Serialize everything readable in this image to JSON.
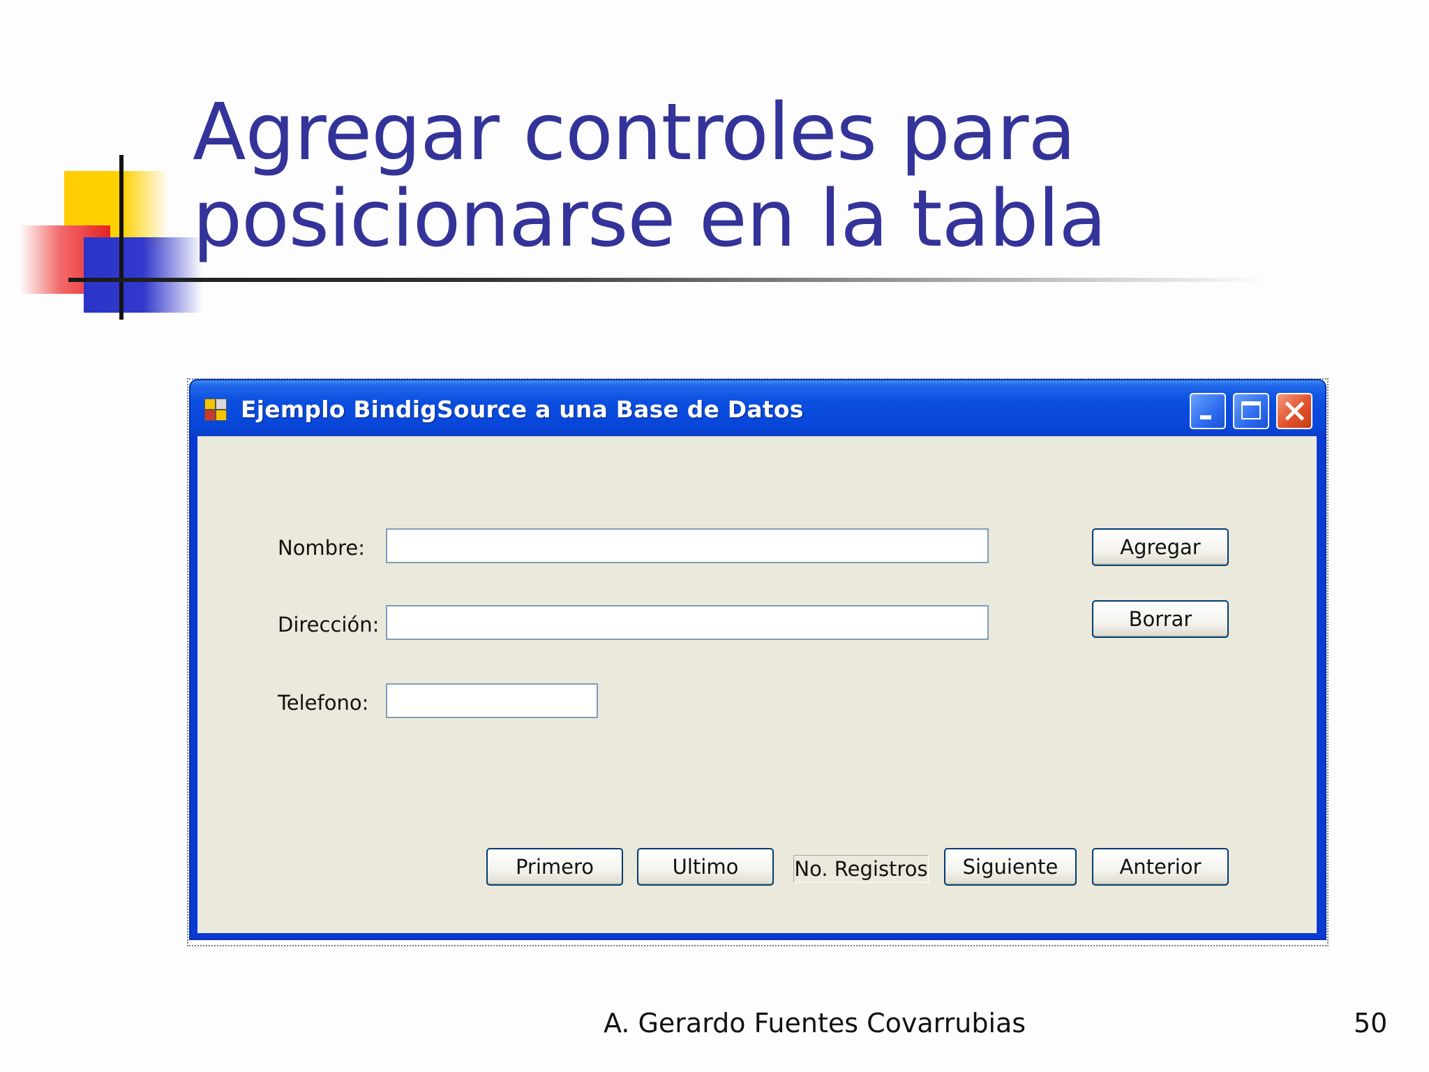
{
  "slide": {
    "title": "Agregar controles para posicionarse en la tabla",
    "author": "A. Gerardo Fuentes Covarrubias",
    "page_number": "50"
  },
  "window": {
    "title": "Ejemplo BindigSource a una Base de Datos",
    "titlebar_color": "#0a4ee0",
    "client_color": "#ebe9db"
  },
  "form": {
    "nombre_label": "Nombre:",
    "nombre_value": "",
    "direccion_label": "Dirección:",
    "direccion_value": "",
    "telefono_label": "Telefono:",
    "telefono_value": "",
    "agregar_label": "Agregar",
    "borrar_label": "Borrar",
    "primero_label": "Primero",
    "ultimo_label": "Ultimo",
    "registros_label": "No. Registros",
    "siguiente_label": "Siguiente",
    "anterior_label": "Anterior"
  }
}
